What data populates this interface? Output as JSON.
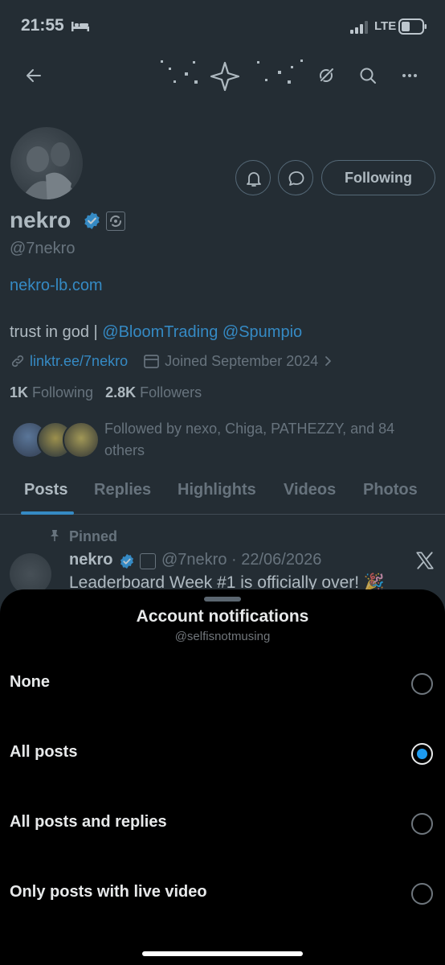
{
  "status_bar": {
    "time": "21:55",
    "network": "LTE"
  },
  "profile": {
    "follow_button": "Following",
    "name": "nekro",
    "handle": "@7nekro",
    "website": "nekro-lb.com",
    "bio_prefix": "trust in god | ",
    "bio_mention_1": "@BloomTrading",
    "bio_mention_2": "@Spumpio",
    "link": "linktr.ee/7nekro",
    "joined": "Joined September 2024",
    "following_count": "1K",
    "following_label": "Following",
    "followers_count": "2.8K",
    "followers_label": "Followers",
    "followed_by": "Followed by nexo, Chiga, PATHEZZY, and 84 others",
    "colors": {
      "accent": "#1d9bf0",
      "muted": "#71767b"
    }
  },
  "tabs": [
    {
      "label": "Posts",
      "active": true
    },
    {
      "label": "Replies"
    },
    {
      "label": "Highlights"
    },
    {
      "label": "Videos"
    },
    {
      "label": "Photos"
    }
  ],
  "pinned_post": {
    "pinned_label": "Pinned",
    "author": "nekro",
    "meta": "@7nekro · 22/06/2026",
    "text": "Leaderboard Week #1 is officially over! 🎉"
  },
  "sheet": {
    "title": "Account notifications",
    "subtitle": "@selfisnotmusing",
    "options": [
      {
        "label": "None",
        "selected": false
      },
      {
        "label": "All posts",
        "selected": true
      },
      {
        "label": "All posts and replies",
        "selected": false
      },
      {
        "label": "Only posts with live video",
        "selected": false
      }
    ]
  }
}
